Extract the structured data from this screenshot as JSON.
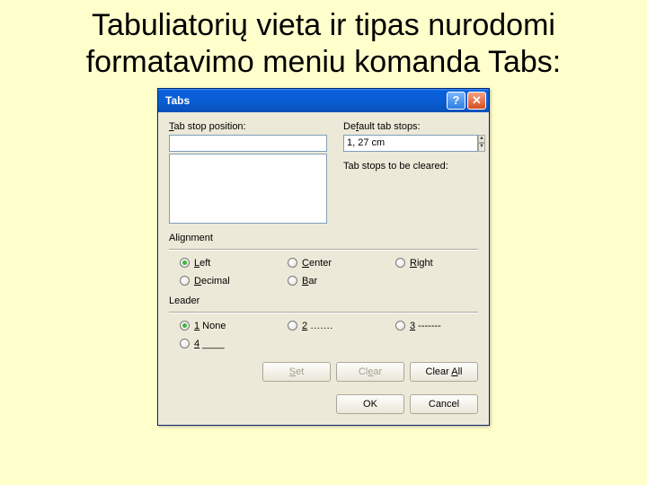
{
  "slide": {
    "title": "Tabuliatorių vieta ir tipas nurodomi formatavimo meniu komanda Tabs:"
  },
  "dialog": {
    "title": "Tabs",
    "tabStopLabel": "Tab stop position:",
    "tabStopValue": "",
    "defaultStopsLabel": "Default tab stops:",
    "defaultStopsValue": "1, 27 cm",
    "clearedLabel": "Tab stops to be cleared:",
    "alignment": {
      "groupLabel": "Alignment",
      "options": {
        "left": "Left",
        "center": "Center",
        "right": "Right",
        "decimal": "Decimal",
        "bar": "Bar"
      },
      "selected": "left"
    },
    "leader": {
      "groupLabel": "Leader",
      "options": {
        "none": "1 None",
        "dots": "2 …….",
        "dashes": "3 -------",
        "underline": "4 ____"
      },
      "selected": "none"
    },
    "buttons": {
      "set": "Set",
      "clear": "Clear",
      "clearAll": "Clear All",
      "ok": "OK",
      "cancel": "Cancel"
    }
  }
}
